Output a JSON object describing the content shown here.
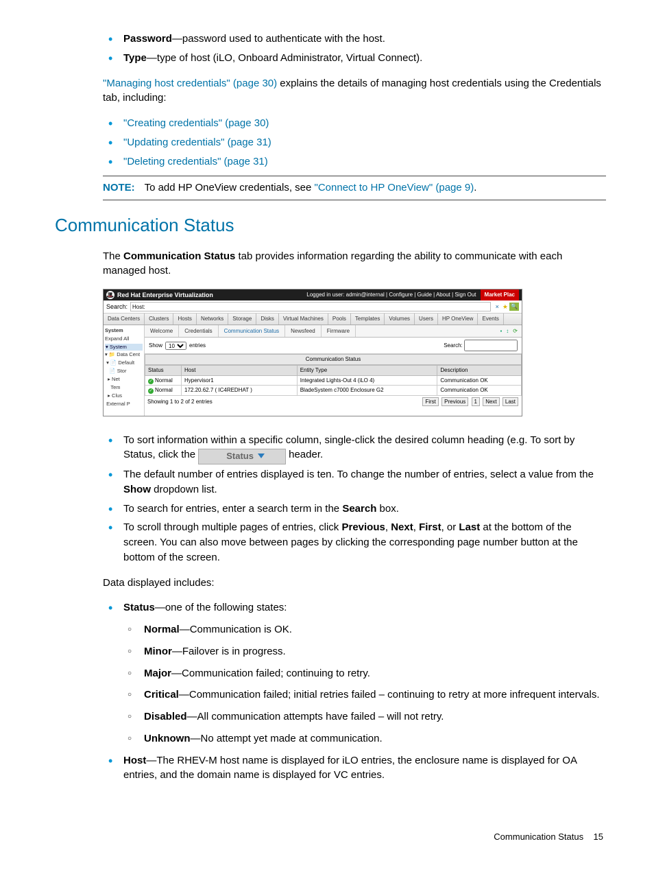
{
  "top_bullets": {
    "password_label": "Password",
    "password_text": "—password used to authenticate with the host.",
    "type_label": "Type",
    "type_text": "—type of host (iLO, Onboard Administrator, Virtual Connect)."
  },
  "cred_para": {
    "link": "\"Managing host credentials\" (page 30)",
    "rest": " explains the details of managing host credentials using the Credentials tab, including:"
  },
  "cred_links": [
    "\"Creating credentials\" (page 30)",
    "\"Updating credentials\" (page 31)",
    "\"Deleting credentials\" (page 31)"
  ],
  "note": {
    "label": "NOTE:",
    "pre": "To add HP OneView credentials, see ",
    "link": "\"Connect to HP OneView\" (page 9)",
    "post": "."
  },
  "section_title": "Communication Status",
  "section_para_pre": "The ",
  "section_para_bold": "Communication Status",
  "section_para_post": " tab provides information regarding the ability to communicate with each managed host.",
  "screenshot": {
    "top_title": "Red Hat Enterprise Virtualization",
    "logged_in": "Logged in user: admin@internal | Configure | Guide | About | Sign Out",
    "market": "Market Plac",
    "search_label": "Search:",
    "search_value": "Host:",
    "tabs": [
      "Data Centers",
      "Clusters",
      "Hosts",
      "Networks",
      "Storage",
      "Disks",
      "Virtual Machines",
      "Pools",
      "Templates",
      "Volumes",
      "Users",
      "HP OneView",
      "Events"
    ],
    "side": {
      "system": "System",
      "expand": "Expand All",
      "sel": "System",
      "items": [
        "Data Cent",
        "Default",
        "Stor",
        "Net",
        "Tem",
        "Clus",
        "External P"
      ]
    },
    "subtabs": [
      "Welcome",
      "Credentials",
      "Communication Status",
      "Newsfeed",
      "Firmware"
    ],
    "show_label": "Show",
    "entries_label": "entries",
    "search2_label": "Search:",
    "banner": "Communication Status",
    "cols": [
      "Status",
      "Host",
      "Entity Type",
      "Description"
    ],
    "rows": [
      {
        "status": "Normal",
        "host": "Hypervisor1",
        "entity": "Integrated Lights-Out 4 (iLO 4)",
        "desc": "Communication OK"
      },
      {
        "status": "Normal",
        "host": "172.20.62.7 ( IC4REDHAT )",
        "entity": "BladeSystem c7000 Enclosure G2",
        "desc": "Communication OK"
      }
    ],
    "showing": "Showing 1 to 2 of 2 entries",
    "pager": [
      "First",
      "Previous",
      "1",
      "Next",
      "Last"
    ]
  },
  "usage": {
    "sort_pre": "To sort information within a specific column, single-click the desired column heading (e.g. To sort by Status, click the ",
    "sort_chip": "Status",
    "sort_post": "header.",
    "default_pre": "The default number of entries displayed is ten. To change the number of entries, select a value from the ",
    "default_bold": "Show",
    "default_post": " dropdown list.",
    "search_pre": "To search for entries, enter a search term in the ",
    "search_bold": "Search",
    "search_post": " box.",
    "scroll_a": "To scroll through multiple pages of entries, click ",
    "scroll_prev": "Previous",
    "scroll_c1": ", ",
    "scroll_next": "Next",
    "scroll_c2": ", ",
    "scroll_first": "First",
    "scroll_c3": ", or ",
    "scroll_last": "Last",
    "scroll_b": " at the bottom of the screen. You can also move between pages by clicking the corresponding page number button at the bottom of the screen."
  },
  "data_includes": "Data displayed includes:",
  "status_line_bold": "Status",
  "status_line_rest": "—one of the following states:",
  "states": [
    {
      "b": "Normal",
      "t": "—Communication is OK."
    },
    {
      "b": "Minor",
      "t": "—Failover is in progress."
    },
    {
      "b": "Major",
      "t": "—Communication failed; continuing to retry."
    },
    {
      "b": "Critical",
      "t": "—Communication failed; initial retries failed – continuing to retry at more infrequent intervals."
    },
    {
      "b": "Disabled",
      "t": "—All communication attempts have failed – will not retry."
    },
    {
      "b": "Unknown",
      "t": "—No attempt yet made at communication."
    }
  ],
  "host_line_bold": "Host",
  "host_line_rest": "—The RHEV-M host name is displayed for iLO entries, the enclosure name is displayed for OA entries, and the domain name is displayed for VC entries.",
  "footer_text": "Communication Status",
  "footer_page": "15"
}
